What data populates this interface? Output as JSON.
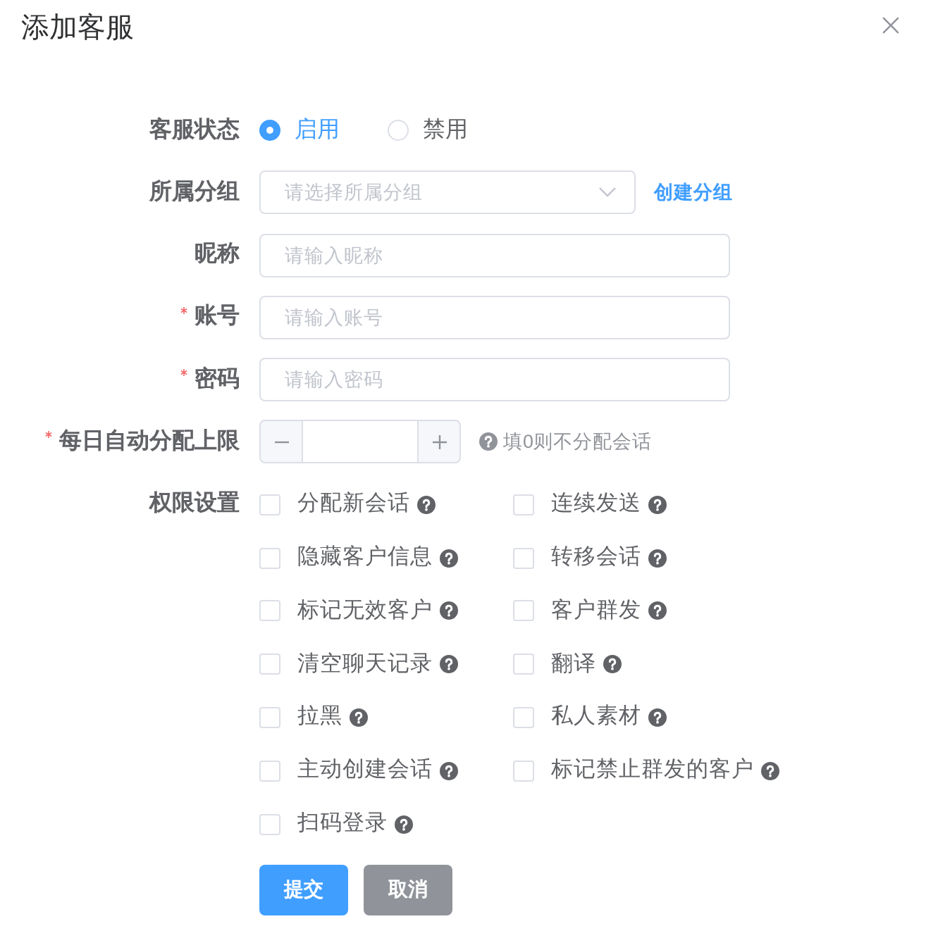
{
  "dialog": {
    "title": "添加客服"
  },
  "form": [
    {
      "kind": "radio",
      "label": "客服状态",
      "required": false,
      "options": [
        {
          "label": "启用",
          "selected": true
        },
        {
          "label": "禁用",
          "selected": false
        }
      ]
    },
    {
      "kind": "select",
      "label": "所属分组",
      "required": false,
      "placeholder": "请选择所属分组",
      "link": "创建分组"
    },
    {
      "kind": "input",
      "label": "昵称",
      "required": false,
      "placeholder": "请输入昵称"
    },
    {
      "kind": "input",
      "label": "账号",
      "required": true,
      "placeholder": "请输入账号"
    },
    {
      "kind": "input",
      "label": "密码",
      "required": true,
      "placeholder": "请输入密码"
    },
    {
      "kind": "number",
      "label": "每日自动分配上限",
      "required": true,
      "hint": "填0则不分配会话"
    },
    {
      "kind": "checkboxes",
      "label": "权限设置",
      "required": false,
      "options": [
        {
          "label": "分配新会话",
          "checked": false
        },
        {
          "label": "连续发送",
          "checked": false
        },
        {
          "label": "隐藏客户信息",
          "checked": false
        },
        {
          "label": "转移会话",
          "checked": false
        },
        {
          "label": "标记无效客户",
          "checked": false
        },
        {
          "label": "客户群发",
          "checked": false
        },
        {
          "label": "清空聊天记录",
          "checked": false
        },
        {
          "label": "翻译",
          "checked": false
        },
        {
          "label": "拉黑",
          "checked": false
        },
        {
          "label": "私人素材",
          "checked": false
        },
        {
          "label": "主动创建会话",
          "checked": false
        },
        {
          "label": "标记禁止群发的客户",
          "checked": false
        },
        {
          "label": "扫码登录",
          "checked": false
        }
      ]
    }
  ],
  "buttons": [
    {
      "label": "提交",
      "kind": "primary"
    },
    {
      "label": "取消",
      "kind": "secondary"
    }
  ]
}
